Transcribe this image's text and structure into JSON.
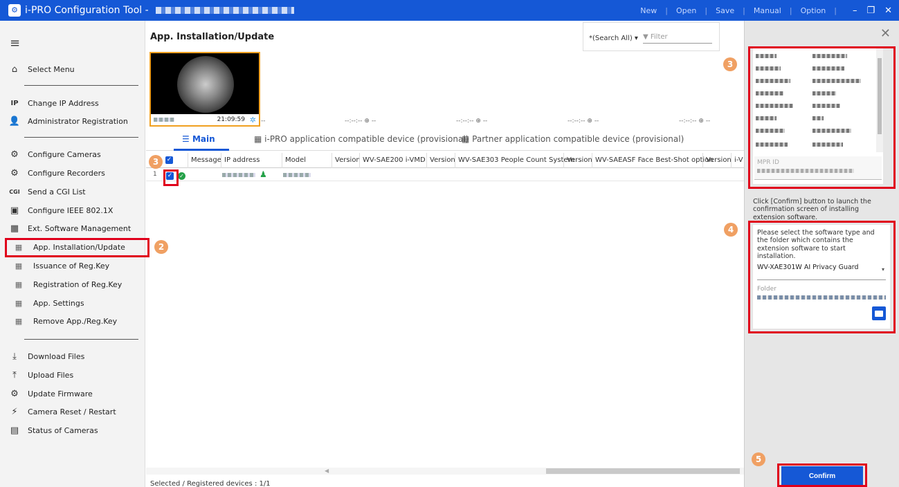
{
  "titlebar": {
    "title": "i-PRO Configuration Tool - ",
    "menu": [
      "New",
      "Open",
      "Save",
      "Manual",
      "Option"
    ],
    "controls": [
      "–",
      "❐",
      "✕"
    ]
  },
  "sidebar": {
    "items": [
      {
        "label": "Select Menu",
        "icon": "⌂"
      },
      {
        "label": "Change IP Address",
        "icon": "IP"
      },
      {
        "label": "Administrator Registration",
        "icon": "👤"
      },
      {
        "label": "Configure Cameras",
        "icon": "⚙"
      },
      {
        "label": "Configure Recorders",
        "icon": "⚙"
      },
      {
        "label": "Send a CGI List",
        "icon": "CGI"
      },
      {
        "label": "Configure IEEE 802.1X",
        "icon": "▣"
      },
      {
        "label": "Ext. Software Management",
        "icon": "▦"
      },
      {
        "label": "App. Installation/Update",
        "icon": "▦"
      },
      {
        "label": "Issuance of Reg.Key",
        "icon": "▦"
      },
      {
        "label": "Registration of Reg.Key",
        "icon": "▦"
      },
      {
        "label": "App. Settings",
        "icon": "▦"
      },
      {
        "label": "Remove App./Reg.Key",
        "icon": "▦"
      },
      {
        "label": "Download Files",
        "icon": "⤓"
      },
      {
        "label": "Upload Files",
        "icon": "⤒"
      },
      {
        "label": "Update Firmware",
        "icon": "⚙"
      },
      {
        "label": "Camera Reset / Restart",
        "icon": "⚡"
      },
      {
        "label": "Status of Cameras",
        "icon": "▤"
      }
    ]
  },
  "main": {
    "page_title": "App. Installation/Update",
    "search": {
      "select": "*(Search All)",
      "filter_placeholder": "Filter"
    },
    "thumbnail": {
      "time": "21:09:59"
    },
    "cam_slots": [
      "--:--:-- ⊕ --",
      "--:--:-- ⊕ --",
      "--:--:-- ⊕ --",
      "--:--:-- ⊕ --"
    ],
    "tabs": [
      "Main",
      "i-PRO application compatible device (provisional)",
      "Partner application compatible device (provisional)"
    ],
    "table": {
      "headers": [
        "Message",
        "IP address",
        "Model",
        "Version",
        "WV-SAE200 i-VMD",
        "Version",
        "WV-SAE303 People Count System",
        "Version",
        "WV-SAEASF Face Best-Shot option",
        "Version",
        "i-V"
      ],
      "row_number": "1"
    },
    "status": "Selected / Registered devices : 1/1"
  },
  "rpanel": {
    "mpr_label": "MPR ID",
    "confirm_desc": "Click [Confirm] button to launch the confirmation screen of installing extension software.",
    "select_desc": "Please select the software type and the folder which contains the extension software to start installation.",
    "software": "WV-XAE301W AI Privacy Guard",
    "folder_label": "Folder",
    "confirm": "Confirm"
  },
  "steps": [
    "2",
    "3",
    "3",
    "4",
    "5"
  ],
  "colors": {
    "accent": "#1558d6",
    "highlight": "#e0001b",
    "step": "#f0a063"
  }
}
